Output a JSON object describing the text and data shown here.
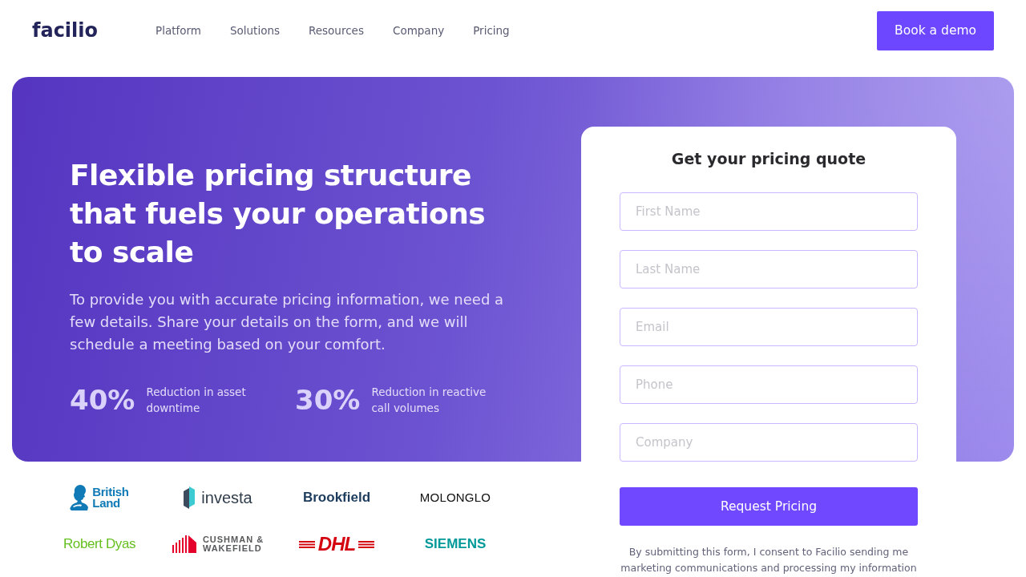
{
  "header": {
    "logo": "facilio",
    "nav": [
      "Platform",
      "Solutions",
      "Resources",
      "Company",
      "Pricing"
    ],
    "cta": "Book a demo"
  },
  "hero": {
    "heading": "Flexible pricing structure that fuels your operations to scale",
    "description": "To provide you with accurate pricing information, we need a few details. Share your details on the form, and we will schedule a meeting based on your comfort.",
    "stats": [
      {
        "value": "40%",
        "label": "Reduction in asset downtime"
      },
      {
        "value": "30%",
        "label": "Reduction in reactive call volumes"
      }
    ]
  },
  "form": {
    "title": "Get your pricing quote",
    "fields": [
      {
        "placeholder": "First Name"
      },
      {
        "placeholder": "Last Name"
      },
      {
        "placeholder": "Email"
      },
      {
        "placeholder": "Phone"
      },
      {
        "placeholder": "Company"
      }
    ],
    "submit": "Request Pricing",
    "consent": "By submitting this form, I consent to Facilio sending me marketing communications and processing my information"
  },
  "client_logos": [
    {
      "lines": [
        "British",
        "Land"
      ],
      "color": "#0f7ab5",
      "kind": "figure"
    },
    {
      "lines": [
        "investa"
      ],
      "color": "#2f3c4a",
      "kind": "prism"
    },
    {
      "lines": [
        "Brookfield"
      ],
      "color": "#1b3a5c",
      "kind": "bold"
    },
    {
      "lines": [
        "MOLONGLO"
      ],
      "color": "#111111",
      "kind": "plain"
    },
    {
      "lines": [
        "Robert Dyas"
      ],
      "color": "#64bf1f",
      "kind": "light"
    },
    {
      "lines": [
        "CUSHMAN &",
        "WAKEFIELD"
      ],
      "color": "#58595b",
      "kind": "bars"
    },
    {
      "lines": [
        "DHL"
      ],
      "color": "#d40511",
      "kind": "stripes"
    },
    {
      "lines": [
        "SIEMENS"
      ],
      "color": "#009999",
      "kind": "bold"
    }
  ]
}
